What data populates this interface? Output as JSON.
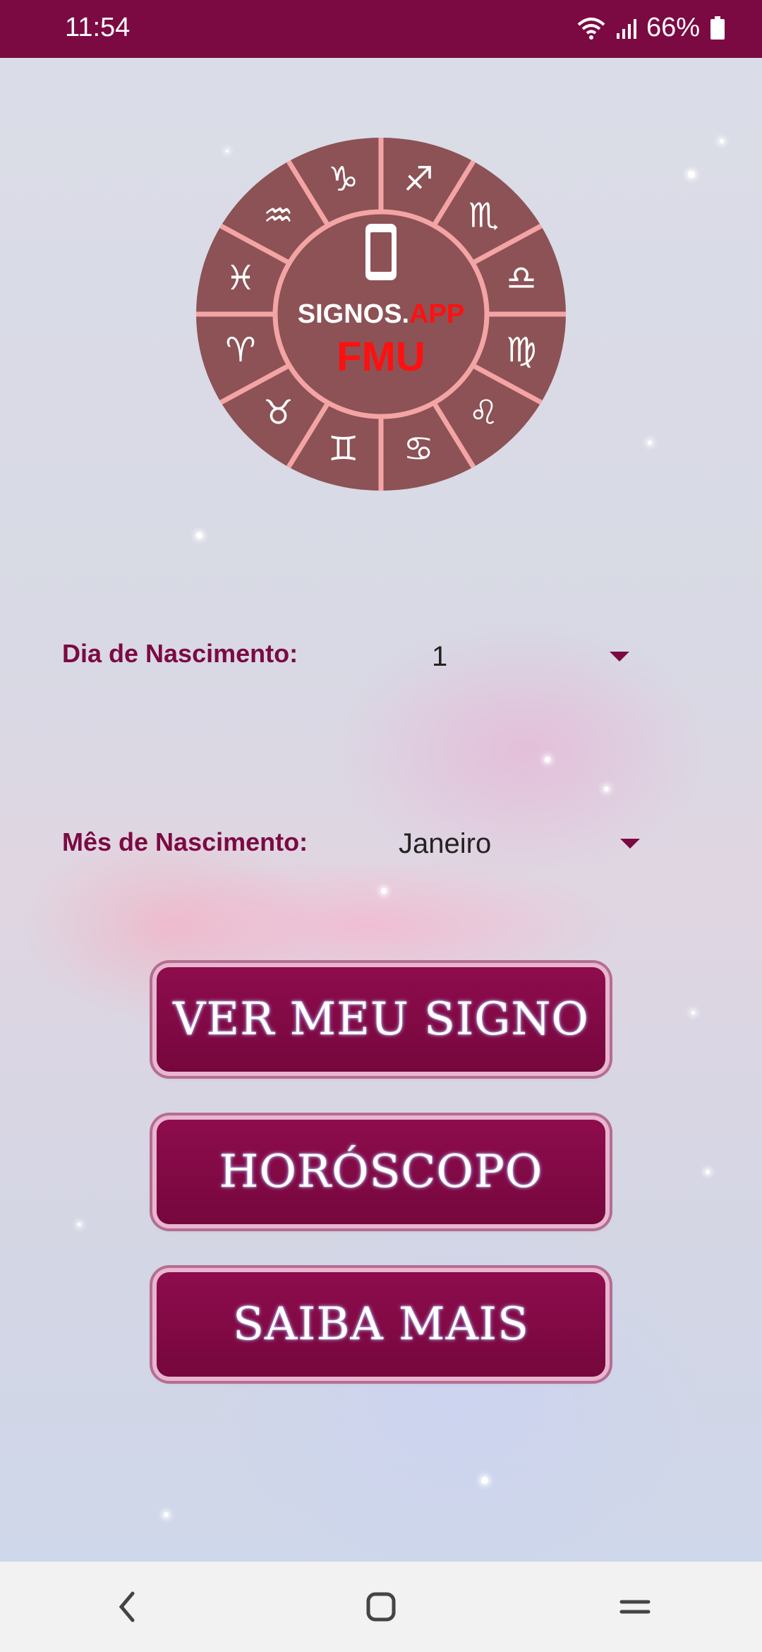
{
  "status_bar": {
    "time": "11:54",
    "battery": "66%"
  },
  "logo": {
    "title_white": "SIGNOS.",
    "title_red": "APP",
    "subtitle": "FMU",
    "zodiac_glyphs": [
      "♐",
      "♏",
      "♎",
      "♍",
      "♌",
      "♋",
      "♊",
      "♉",
      "♈",
      "♓",
      "♒",
      "♑"
    ]
  },
  "form": {
    "day_label": "Dia de Nascimento:",
    "day_value": "1",
    "month_label": "Mês de Nascimento:",
    "month_value": "Janeiro"
  },
  "buttons": {
    "sign": "VER MEU SIGNO",
    "horoscope": "HORÓSCOPO",
    "more": "SAIBA MAIS"
  },
  "colors": {
    "primary": "#7b0a43",
    "wheel": "#8c5256",
    "wheel_lines": "#f4a4a4",
    "logo_red": "#ff1010"
  }
}
